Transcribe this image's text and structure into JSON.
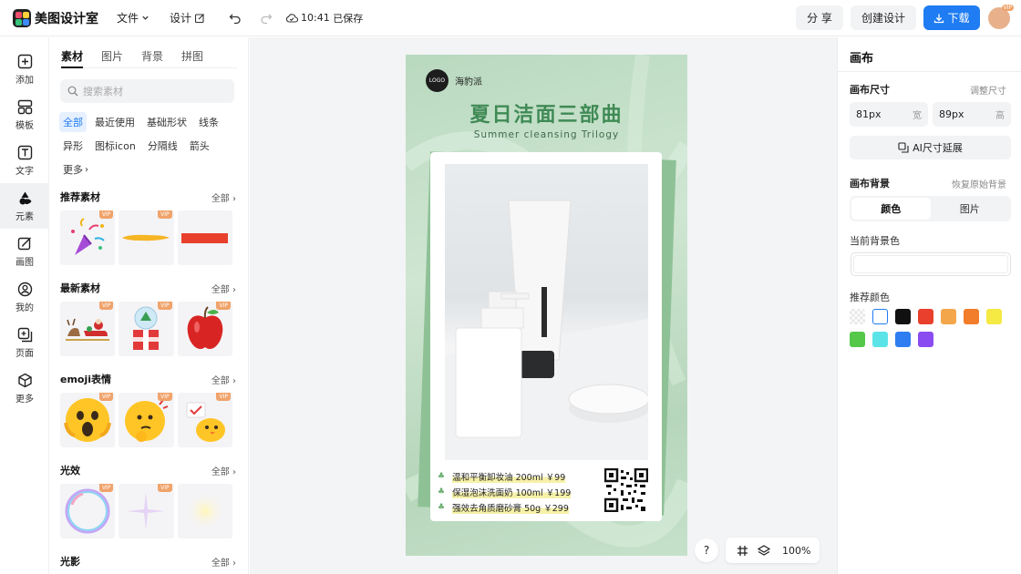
{
  "app": {
    "name": "美图设计室"
  },
  "topbar": {
    "file": "文件",
    "design": "设计",
    "save_time": "10:41",
    "save_status": "已保存",
    "share": "分 享",
    "create": "创建设计",
    "download": "下载"
  },
  "leftnav": {
    "items": [
      {
        "label": "添加",
        "icon": "plus-box-icon"
      },
      {
        "label": "模板",
        "icon": "template-icon"
      },
      {
        "label": "文字",
        "icon": "text-icon"
      },
      {
        "label": "元素",
        "icon": "shapes-icon"
      },
      {
        "label": "画图",
        "icon": "pen-icon"
      },
      {
        "label": "我的",
        "icon": "user-icon"
      },
      {
        "label": "页面",
        "icon": "page-icon"
      },
      {
        "label": "更多",
        "icon": "cube-icon"
      }
    ],
    "active_index": 3
  },
  "panel": {
    "tabs": [
      "素材",
      "图片",
      "背景",
      "拼图"
    ],
    "search_placeholder": "搜索素材",
    "chips": [
      "全部",
      "最近使用",
      "基础形状",
      "线条",
      "异形",
      "图标icon",
      "分隔线",
      "箭头",
      "更多"
    ],
    "all_label": "全部",
    "sections": [
      {
        "title": "推荐素材",
        "items": [
          "confetti",
          "yellow-brush",
          "red-bar"
        ]
      },
      {
        "title": "最新素材",
        "items": [
          "sleigh",
          "snow-globe",
          "apple"
        ]
      },
      {
        "title": "emoji表情",
        "items": [
          "shocked-emoji",
          "thinking-emoji",
          "chick-emoji"
        ]
      },
      {
        "title": "光效",
        "items": [
          "bubble",
          "sparkle",
          "glow"
        ]
      },
      {
        "title": "光影",
        "items": []
      }
    ],
    "vip_label": "VIP"
  },
  "poster": {
    "logo": "LOGO",
    "brand": "海豹派",
    "title": "夏日洁面三部曲",
    "subtitle": "Summer cleansing Trilogy",
    "prices": [
      "温和平衡卸妆油 200ml ￥99",
      "保湿泡沫洗面奶 100ml ￥199",
      "强效去角质磨砂膏 50g ￥299"
    ]
  },
  "canvas_tools": {
    "help": "?",
    "zoom": "100%"
  },
  "rightpanel": {
    "title": "画布",
    "size_label": "画布尺寸",
    "resize_link": "调整尺寸",
    "width_value": "81px",
    "width_unit": "宽",
    "height_value": "89px",
    "height_unit": "高",
    "ai_button": "AI尺寸延展",
    "bg_label": "画布背景",
    "restore_link": "恢复原始背景",
    "seg_color": "颜色",
    "seg_image": "图片",
    "current_bg_label": "当前背景色",
    "recommend_label": "推荐颜色",
    "swatches": [
      "transparent",
      "#ffffff",
      "#111111",
      "#e8402c",
      "#f4a74a",
      "#f27d2a",
      "#f5e943",
      "#55c84a",
      "#5be4e8",
      "#2f7ef1",
      "#8a4cf0"
    ]
  }
}
